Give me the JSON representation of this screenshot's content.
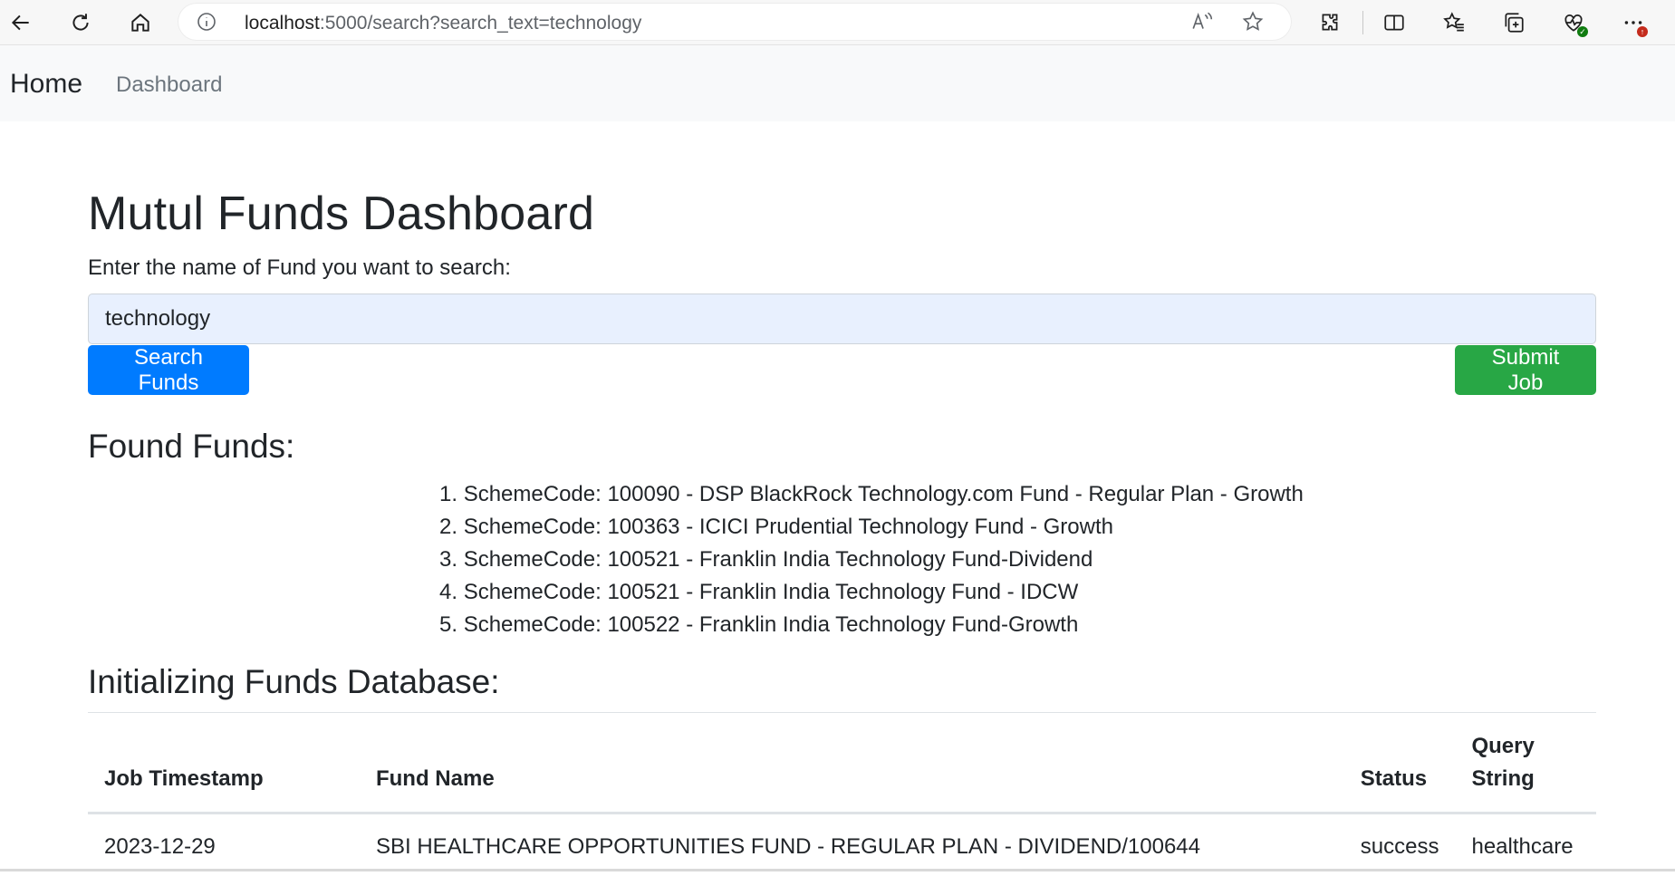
{
  "browser": {
    "url_host": "localhost",
    "url_rest": ":5000/search?search_text=technology",
    "icons": [
      "back-icon",
      "refresh-icon",
      "home-icon",
      "info-icon",
      "read-aloud-icon",
      "favorite-star-icon",
      "extensions-icon",
      "split-screen-icon",
      "favorites-icon",
      "collections-icon",
      "browser-essentials-icon",
      "more-icon"
    ]
  },
  "navbar": {
    "brand": "Home",
    "link": "Dashboard"
  },
  "page": {
    "title": "Mutul Funds Dashboard",
    "search_label": "Enter the name of Fund you want to search:",
    "search_value": "technology",
    "search_button": "Search Funds",
    "submit_button": "Submit Job",
    "found_title": "Found Funds:",
    "results": [
      "SchemeCode: 100090 - DSP BlackRock Technology.com Fund - Regular Plan - Growth",
      "SchemeCode: 100363 - ICICI Prudential Technology Fund - Growth",
      "SchemeCode: 100521 - Franklin India Technology Fund-Dividend",
      "SchemeCode: 100521 - Franklin India Technology Fund - IDCW",
      "SchemeCode: 100522 - Franklin India Technology Fund-Growth"
    ],
    "init_title": "Initializing Funds Database:",
    "table": {
      "headers": [
        "Job Timestamp",
        "Fund Name",
        "Status",
        "Query String"
      ],
      "rows": [
        [
          "2023-12-29",
          "SBI HEALTHCARE OPPORTUNITIES FUND - REGULAR PLAN - DIVIDEND/100644",
          "success",
          "healthcare"
        ]
      ]
    }
  },
  "colors": {
    "primary": "#007bff",
    "success": "#28a745",
    "navbar_bg": "#f8f9fa",
    "input_bg": "#e8f0fe"
  }
}
